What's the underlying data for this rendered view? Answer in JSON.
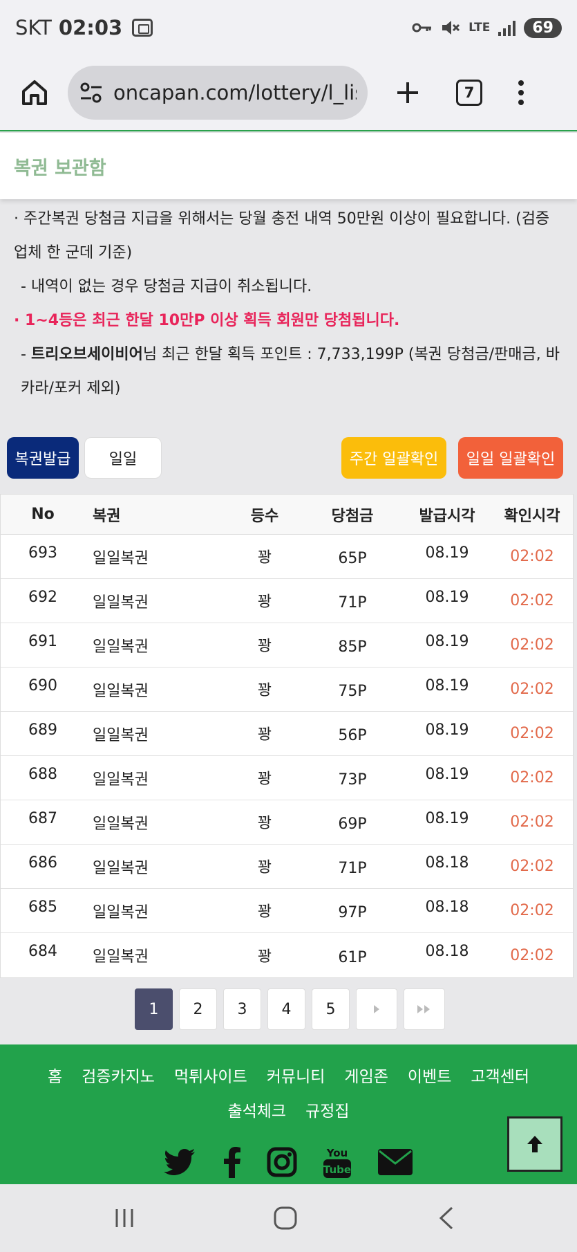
{
  "status_bar": {
    "carrier": "SKT",
    "time": "02:03",
    "network": "LTE",
    "battery": "69",
    "icons": [
      "screenshot-icon",
      "key-icon",
      "mute-icon",
      "signal-icon"
    ]
  },
  "browser": {
    "url": "oncapan.com/lottery/l_list.php",
    "tab_count": "7"
  },
  "page": {
    "title": "복권 보관함"
  },
  "notices": {
    "line1": "· 주간복권 당첨금 지급을 위해서는 당월 충전 내역 50만원 이상이 필요합니다. (검증업체 한 군데 기준)",
    "line2": "- 내역이 없는 경우 당첨금 지급이 취소됩니다.",
    "line3": "· 1~4등은 최근 한달 10만P 이상 획득 회원만 당첨됩니다.",
    "line4_prefix": "- ",
    "line4_user": "트리오브세이비어",
    "line4_rest": "님 최근 한달 획득 포인트 : 7,733,199P (복권 당첨금/판매금, 바카라/포커 제외)"
  },
  "buttons": {
    "issue": "복권발급",
    "daily": "일일",
    "weekly_confirm": "주간 일괄확인",
    "daily_confirm": "일일 일괄확인"
  },
  "table": {
    "headers": [
      "No",
      "복권",
      "등수",
      "당첨금",
      "발급시각",
      "확인시각"
    ],
    "rows": [
      {
        "no": "693",
        "name": "일일복권",
        "rank": "꽝",
        "prize": "65P",
        "issued": "08.19",
        "checked": "02:02"
      },
      {
        "no": "692",
        "name": "일일복권",
        "rank": "꽝",
        "prize": "71P",
        "issued": "08.19",
        "checked": "02:02"
      },
      {
        "no": "691",
        "name": "일일복권",
        "rank": "꽝",
        "prize": "85P",
        "issued": "08.19",
        "checked": "02:02"
      },
      {
        "no": "690",
        "name": "일일복권",
        "rank": "꽝",
        "prize": "75P",
        "issued": "08.19",
        "checked": "02:02"
      },
      {
        "no": "689",
        "name": "일일복권",
        "rank": "꽝",
        "prize": "56P",
        "issued": "08.19",
        "checked": "02:02"
      },
      {
        "no": "688",
        "name": "일일복권",
        "rank": "꽝",
        "prize": "73P",
        "issued": "08.19",
        "checked": "02:02"
      },
      {
        "no": "687",
        "name": "일일복권",
        "rank": "꽝",
        "prize": "69P",
        "issued": "08.19",
        "checked": "02:02"
      },
      {
        "no": "686",
        "name": "일일복권",
        "rank": "꽝",
        "prize": "71P",
        "issued": "08.18",
        "checked": "02:02"
      },
      {
        "no": "685",
        "name": "일일복권",
        "rank": "꽝",
        "prize": "97P",
        "issued": "08.18",
        "checked": "02:02"
      },
      {
        "no": "684",
        "name": "일일복권",
        "rank": "꽝",
        "prize": "61P",
        "issued": "08.18",
        "checked": "02:02"
      }
    ]
  },
  "pagination": {
    "pages": [
      "1",
      "2",
      "3",
      "4",
      "5"
    ],
    "active": "1"
  },
  "footer": {
    "links": [
      "홈",
      "검증카지노",
      "먹튀사이트",
      "커뮤니티",
      "게임존",
      "이벤트",
      "고객센터",
      "출석체크",
      "규정집"
    ],
    "social": [
      "twitter-icon",
      "facebook-icon",
      "instagram-icon",
      "youtube-icon",
      "email-icon"
    ]
  },
  "colors": {
    "accent_green": "#22a24b",
    "header_title": "#8fba93",
    "issue_button": "#0a2a7a",
    "weekly_button": "#fbbd0b",
    "daily_all_button": "#f2613a",
    "check_time": "#e2694a",
    "notice_red": "#e8245a"
  }
}
